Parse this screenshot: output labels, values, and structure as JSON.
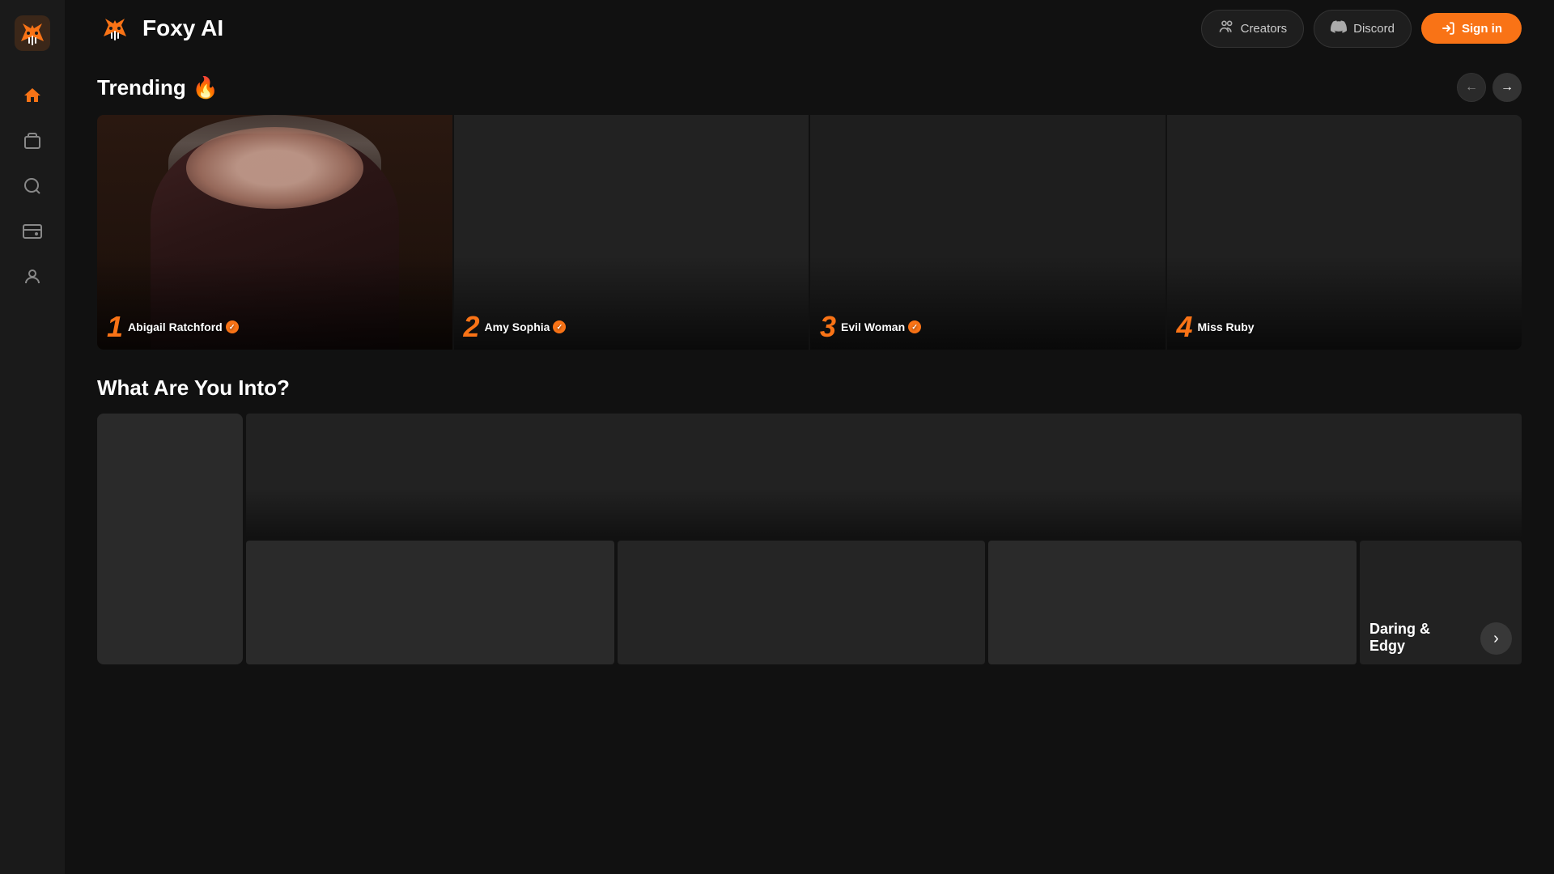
{
  "app": {
    "name": "Foxy AI",
    "logo_alt": "Foxy AI Logo"
  },
  "header": {
    "creators_label": "Creators",
    "discord_label": "Discord",
    "signin_label": "Sign in"
  },
  "sidebar": {
    "nav_items": [
      {
        "id": "home",
        "icon": "home",
        "active": true
      },
      {
        "id": "gallery",
        "icon": "gallery",
        "active": false
      },
      {
        "id": "search",
        "icon": "search",
        "active": false
      },
      {
        "id": "wallet",
        "icon": "wallet",
        "active": false
      },
      {
        "id": "profile",
        "icon": "profile",
        "active": false
      }
    ]
  },
  "trending": {
    "title": "Trending",
    "fire_emoji": "🔥",
    "nav_prev": "←",
    "nav_next": "→",
    "items": [
      {
        "rank": "1",
        "name": "Abigail Ratchford",
        "verified": true
      },
      {
        "rank": "2",
        "name": "Amy Sophia",
        "verified": true
      },
      {
        "rank": "3",
        "name": "Evil Woman",
        "verified": true
      },
      {
        "rank": "4",
        "name": "Miss Ruby",
        "verified": false
      }
    ]
  },
  "categories": {
    "section_title": "What Are You Into?",
    "daring_edgy_label": "Daring & Edgy"
  }
}
